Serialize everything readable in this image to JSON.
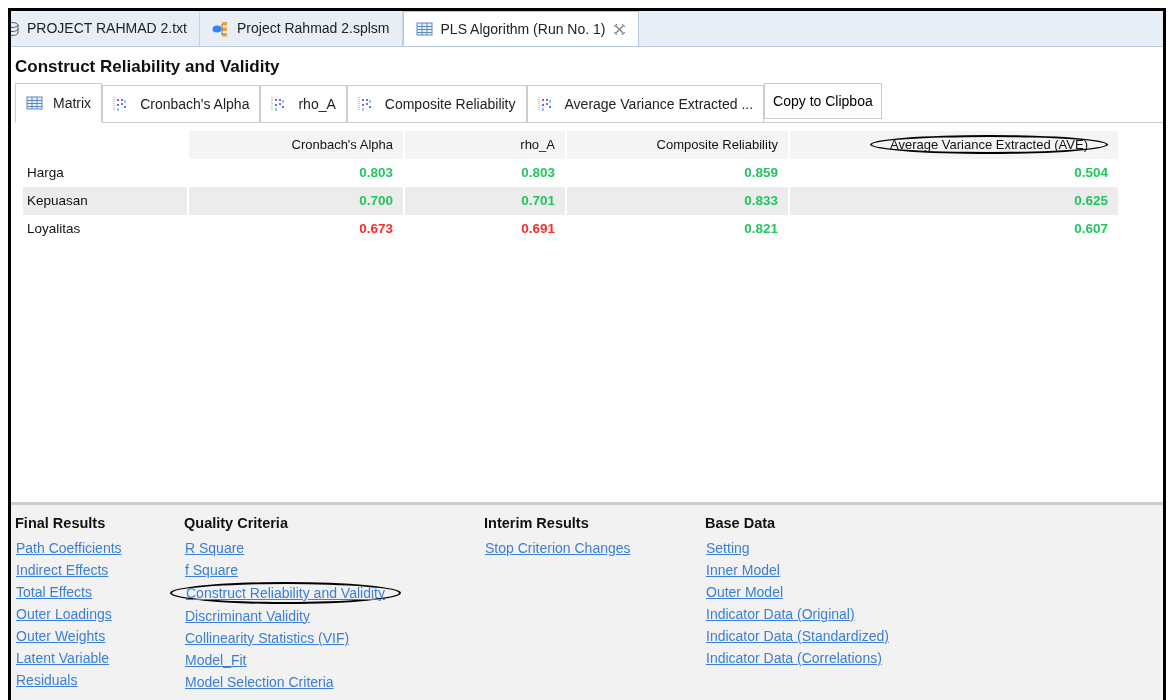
{
  "editor_tabs": [
    {
      "label": "PROJECT RAHMAD 2.txt",
      "kind": "text",
      "selected": false
    },
    {
      "label": "Project Rahmad 2.splsm",
      "kind": "model",
      "selected": false
    },
    {
      "label": "PLS Algorithm (Run No. 1)",
      "kind": "matrix",
      "selected": true,
      "closable": true
    }
  ],
  "title": "Construct Reliability and Validity",
  "view_tabs": [
    {
      "label": "Matrix",
      "kind": "matrix",
      "selected": true
    },
    {
      "label": "Cronbach's Alpha",
      "kind": "chart",
      "selected": false
    },
    {
      "label": "rho_A",
      "kind": "chart",
      "selected": false
    },
    {
      "label": "Composite Reliability",
      "kind": "chart",
      "selected": false
    },
    {
      "label": "Average Variance Extracted ...",
      "kind": "chart",
      "selected": false
    }
  ],
  "copy_button": "Copy to Clipboa",
  "table": {
    "columns": [
      {
        "label": "Cronbach's Alpha",
        "circled": false
      },
      {
        "label": "rho_A",
        "circled": false
      },
      {
        "label": "Composite Reliability",
        "circled": false
      },
      {
        "label": "Average Variance Extracted (AVE)",
        "circled": true
      }
    ],
    "rows": [
      {
        "name": "Harga",
        "cells": [
          {
            "value": "0.803",
            "ok": true
          },
          {
            "value": "0.803",
            "ok": true
          },
          {
            "value": "0.859",
            "ok": true
          },
          {
            "value": "0.504",
            "ok": true
          }
        ]
      },
      {
        "name": "Kepuasan",
        "cells": [
          {
            "value": "0.700",
            "ok": true
          },
          {
            "value": "0.701",
            "ok": true
          },
          {
            "value": "0.833",
            "ok": true
          },
          {
            "value": "0.625",
            "ok": true
          }
        ]
      },
      {
        "name": "Loyalitas",
        "cells": [
          {
            "value": "0.673",
            "ok": false
          },
          {
            "value": "0.691",
            "ok": false
          },
          {
            "value": "0.821",
            "ok": true
          },
          {
            "value": "0.607",
            "ok": true
          }
        ]
      }
    ]
  },
  "sections": [
    {
      "heading": "Final Results",
      "links": [
        {
          "label": "Path Coefficients",
          "circled": false
        },
        {
          "label": "Indirect Effects",
          "circled": false
        },
        {
          "label": "Total Effects",
          "circled": false
        },
        {
          "label": "Outer Loadings",
          "circled": false
        },
        {
          "label": "Outer Weights",
          "circled": false
        },
        {
          "label": "Latent Variable",
          "circled": false
        },
        {
          "label": "Residuals",
          "circled": false
        }
      ]
    },
    {
      "heading": "Quality Criteria",
      "links": [
        {
          "label": "R Square",
          "circled": false
        },
        {
          "label": "f Square",
          "circled": false
        },
        {
          "label": "Construct Reliability and Validity",
          "circled": true
        },
        {
          "label": "Discriminant Validity",
          "circled": false
        },
        {
          "label": "Collinearity Statistics (VIF)",
          "circled": false
        },
        {
          "label": "Model_Fit",
          "circled": false
        },
        {
          "label": "Model Selection Criteria",
          "circled": false
        }
      ]
    },
    {
      "heading": "Interim Results",
      "links": [
        {
          "label": "Stop Criterion Changes",
          "circled": false
        }
      ]
    },
    {
      "heading": "Base Data",
      "links": [
        {
          "label": "Setting",
          "circled": false
        },
        {
          "label": "Inner Model",
          "circled": false
        },
        {
          "label": "Outer Model",
          "circled": false
        },
        {
          "label": "Indicator Data (Original)",
          "circled": false
        },
        {
          "label": "Indicator Data (Standardized)",
          "circled": false
        },
        {
          "label": "Indicator Data (Correlations)",
          "circled": false
        }
      ]
    }
  ]
}
